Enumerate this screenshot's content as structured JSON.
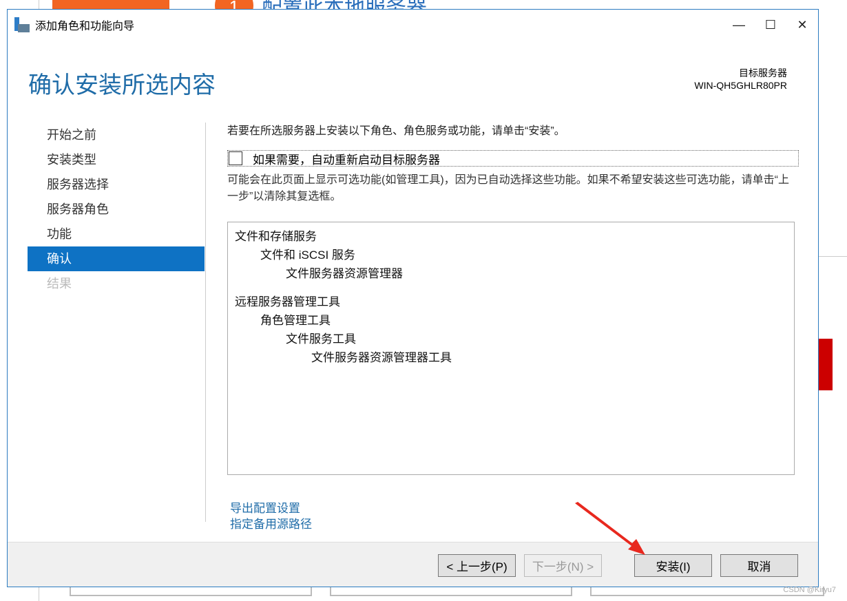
{
  "background": {
    "step_number": "1",
    "step_title": "配置此本地服务器"
  },
  "window": {
    "title": "添加角色和功能向导",
    "minimize": "—",
    "maximize": "☐",
    "close": "✕"
  },
  "header": {
    "page_title": "确认安装所选内容",
    "target_label": "目标服务器",
    "target_value": "WIN-QH5GHLR80PR"
  },
  "nav": {
    "items": [
      {
        "label": "开始之前",
        "state": "normal"
      },
      {
        "label": "安装类型",
        "state": "normal"
      },
      {
        "label": "服务器选择",
        "state": "normal"
      },
      {
        "label": "服务器角色",
        "state": "normal"
      },
      {
        "label": "功能",
        "state": "normal"
      },
      {
        "label": "确认",
        "state": "active"
      },
      {
        "label": "结果",
        "state": "disabled"
      }
    ]
  },
  "main": {
    "intro": "若要在所选服务器上安装以下角色、角色服务或功能，请单击“安装”。",
    "restart_checkbox": {
      "label": "如果需要，自动重新启动目标服务器",
      "checked": false
    },
    "note": "可能会在此页面上显示可选功能(如管理工具)，因为已自动选择这些功能。如果不希望安装这些可选功能，请单击“上一步”以清除其复选框。",
    "items": [
      {
        "label": "文件和存储服务",
        "level": 0
      },
      {
        "label": "文件和 iSCSI 服务",
        "level": 1
      },
      {
        "label": "文件服务器资源管理器",
        "level": 2
      },
      {
        "label": "远程服务器管理工具",
        "level": 0,
        "gap": true
      },
      {
        "label": "角色管理工具",
        "level": 1
      },
      {
        "label": "文件服务工具",
        "level": 2
      },
      {
        "label": "文件服务器资源管理器工具",
        "level": 3
      }
    ],
    "links": {
      "export": "导出配置设置",
      "alt_source": "指定备用源路径"
    }
  },
  "footer": {
    "prev": "< 上一步(P)",
    "next": "下一步(N) >",
    "install": "安装(I)",
    "cancel": "取消"
  },
  "watermark": "CSDN @Kiryu7",
  "colors": {
    "accent": "#0e72c4",
    "title": "#1f6ca8",
    "annotation_arrow": "#e8281e"
  }
}
